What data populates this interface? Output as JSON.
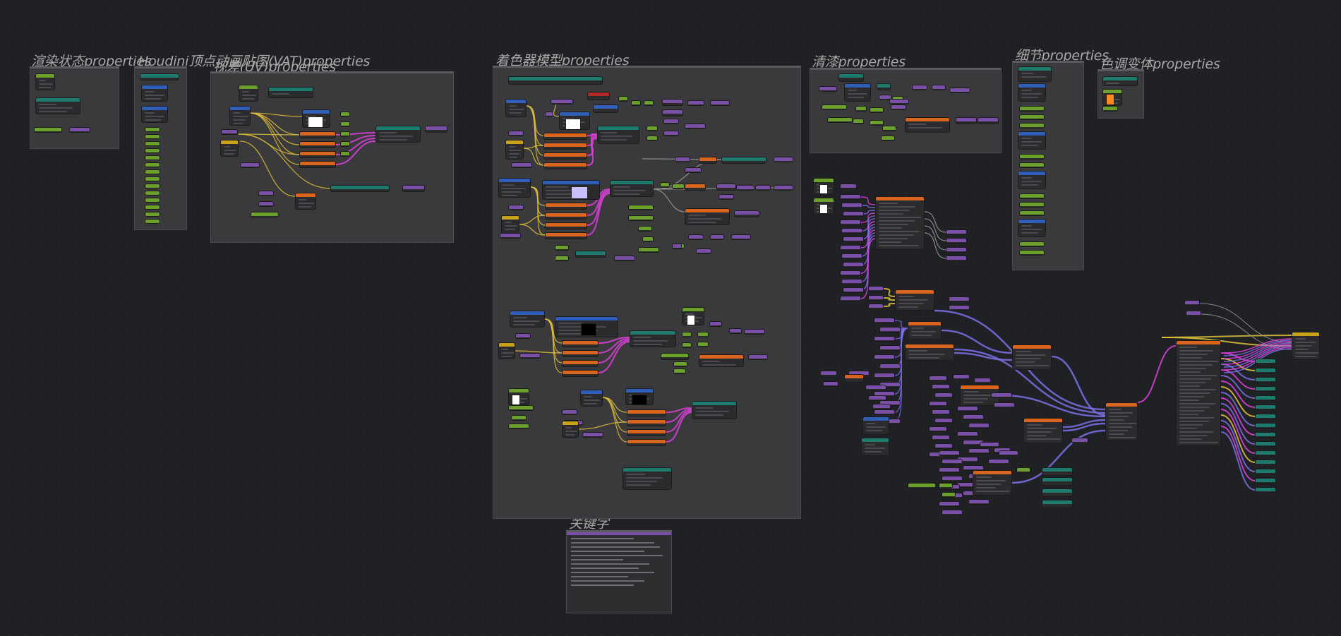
{
  "frames": {
    "render_state": "渲染状态properties",
    "houdini_vat": "Houdini顶点动画贴图(VAT)properties",
    "view_uv": "视差(UV)properties",
    "shader_model": "着色器模型properties",
    "clear_coat": "清漆properties",
    "detail": "细节properties",
    "color_variation": "色调变体properties",
    "keywords": "关键字"
  },
  "colors": {
    "background": "#202124",
    "frame": "#3a3a3c",
    "node_body": "#2b2b2d",
    "header_teal": "#1f7a6e",
    "header_green": "#6aa02b",
    "header_purple": "#7a4fa8",
    "header_orange": "#d9641e",
    "header_blue": "#2f5fb8",
    "header_yellow": "#c9a21a",
    "header_red": "#b02a2a",
    "wire_yellow": "#e2c23a",
    "wire_magenta": "#e040e0",
    "wire_violet": "#7b6ee8",
    "wire_gray": "#9a9a9a"
  }
}
